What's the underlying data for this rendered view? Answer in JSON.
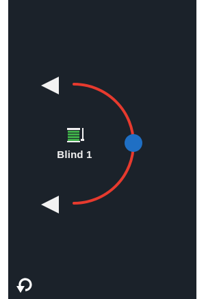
{
  "device": {
    "name": "Blind 1",
    "icon": "blind-icon",
    "icon_color": "#3fae49"
  },
  "controls": {
    "up_icon": "triangle-left-icon",
    "down_icon": "triangle-left-icon",
    "rotate_icon": "rotate-icon"
  },
  "colors": {
    "background": "#1b222a",
    "arc": "#e63a2e",
    "knob": "#1f6fc4",
    "arrow": "#f2f2f2"
  }
}
